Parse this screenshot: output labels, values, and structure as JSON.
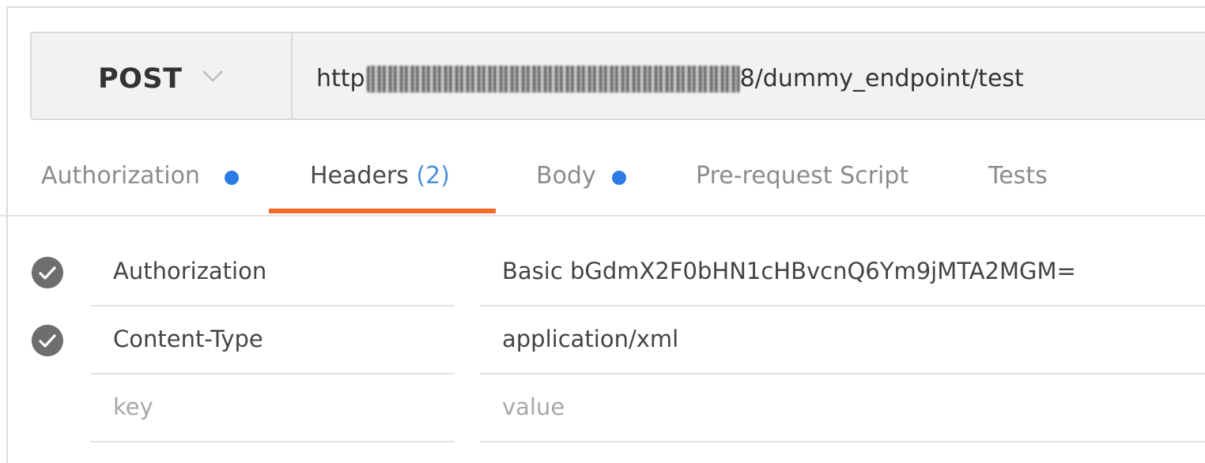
{
  "request": {
    "method": "POST",
    "url_prefix": "http",
    "url_suffix": "8/dummy_endpoint/test"
  },
  "tabs": [
    {
      "label": "Authorization",
      "dot": true
    },
    {
      "label": "Headers",
      "count": "(2)",
      "active": true
    },
    {
      "label": "Body",
      "dot": true
    },
    {
      "label": "Pre-request Script"
    },
    {
      "label": "Tests"
    }
  ],
  "headers": [
    {
      "key": "Authorization",
      "value": "Basic bGdmX2F0bHN1cHBvcnQ6Ym9jMTA2MGM=",
      "enabled": true
    },
    {
      "key": "Content-Type",
      "value": "application/xml",
      "enabled": true
    }
  ],
  "new_header": {
    "key_placeholder": "key",
    "value_placeholder": "value"
  },
  "colors": {
    "accent_underline": "#f26b2b",
    "dot_blue": "#2b7be4",
    "count_blue": "#4a90d9",
    "check_gray": "#6e6e6e"
  },
  "icons": {
    "method_dropdown": "chevron-down-icon",
    "row_enabled": "checkmark-circle-icon"
  }
}
